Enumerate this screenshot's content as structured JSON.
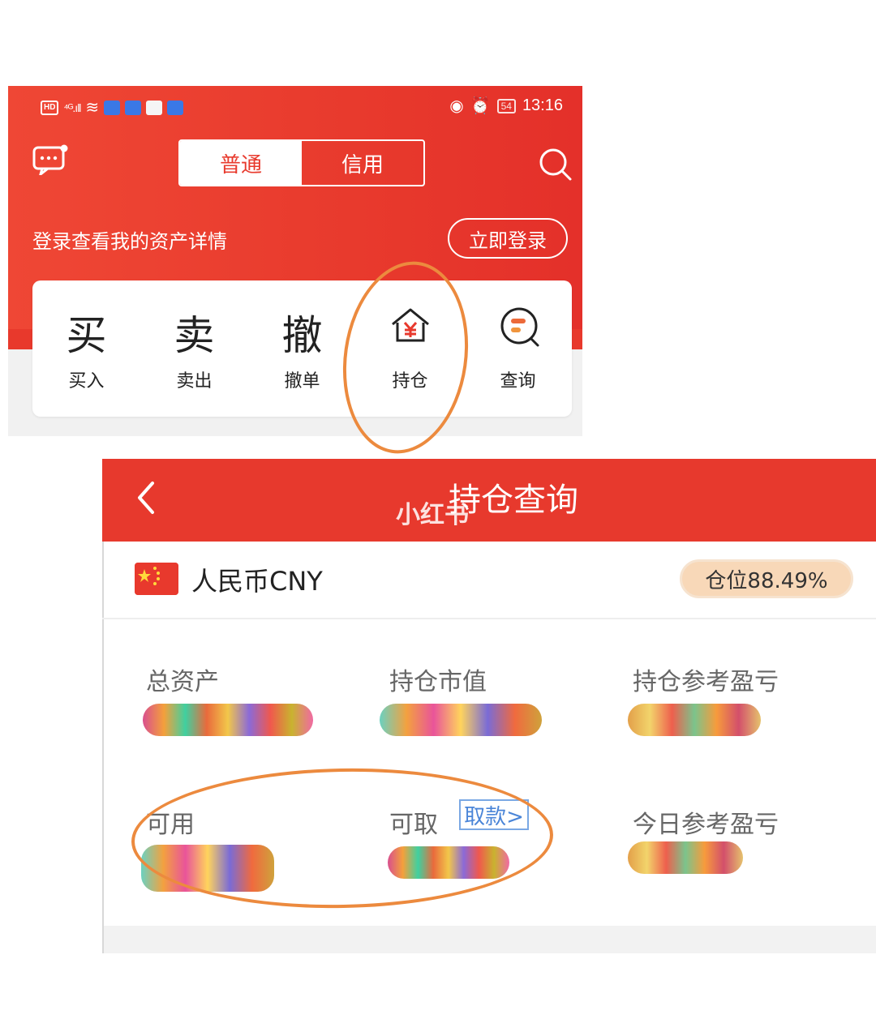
{
  "top_screen": {
    "status_bar": {
      "network": "⁴ᴳ.ıll",
      "battery": "54",
      "time": "13:16"
    },
    "tabs": {
      "normal": "普通",
      "credit": "信用"
    },
    "login_prompt": "登录查看我的资产详情",
    "login_button": "立即登录",
    "quick_actions": [
      {
        "glyph": "买",
        "label": "买入"
      },
      {
        "glyph": "卖",
        "label": "卖出"
      },
      {
        "glyph": "撤",
        "label": "撤单"
      },
      {
        "glyph": "",
        "label": "持仓"
      },
      {
        "glyph": "",
        "label": "查询"
      }
    ]
  },
  "bottom_screen": {
    "title": "持仓查询",
    "watermark": "小红书",
    "currency": "人民币CNY",
    "position_ratio": "仓位88.49%",
    "metrics": {
      "total_assets": "总资产",
      "market_value": "持仓市值",
      "position_pnl": "持仓参考盈亏",
      "available": "可用",
      "withdrawable": "可取",
      "today_pnl": "今日参考盈亏"
    },
    "withdraw_link": "取款>"
  },
  "colors": {
    "brand_red": "#e7392d",
    "annotation_orange": "#ec8a3e",
    "link_blue": "#4a85d8"
  }
}
